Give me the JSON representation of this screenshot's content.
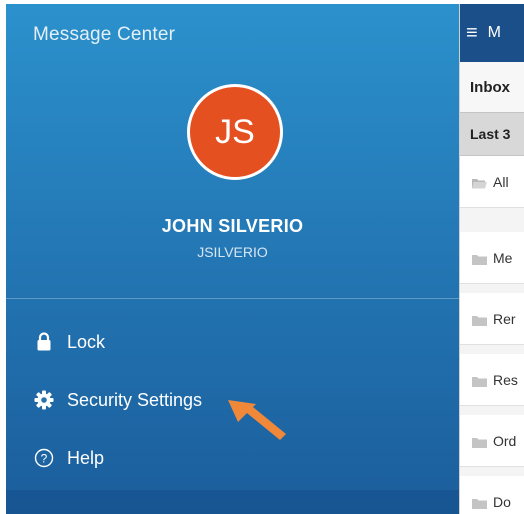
{
  "drawer": {
    "title": "Message Center",
    "avatar_initials": "JS",
    "user_name": "JOHN SILVERIO",
    "user_id": "JSILVERIO",
    "menu": [
      {
        "label": "Lock",
        "icon": "lock-icon"
      },
      {
        "label": "Security Settings",
        "icon": "gear-icon"
      },
      {
        "label": "Help",
        "icon": "help-circle-icon"
      }
    ],
    "colors": {
      "avatar": "#e55020",
      "drawer_top": "#2b91cc",
      "drawer_bottom": "#1b5d9c",
      "pointer_arrow": "#f0883a"
    }
  },
  "right_panel": {
    "header_title": "M",
    "inbox_label": "Inbox",
    "filter_label": "Last 3",
    "folders": [
      "All",
      "Me",
      "Rer",
      "Res",
      "Ord",
      "Do"
    ],
    "colors": {
      "header": "#1a4f8a",
      "filter_bar": "#d8d8d8"
    }
  }
}
